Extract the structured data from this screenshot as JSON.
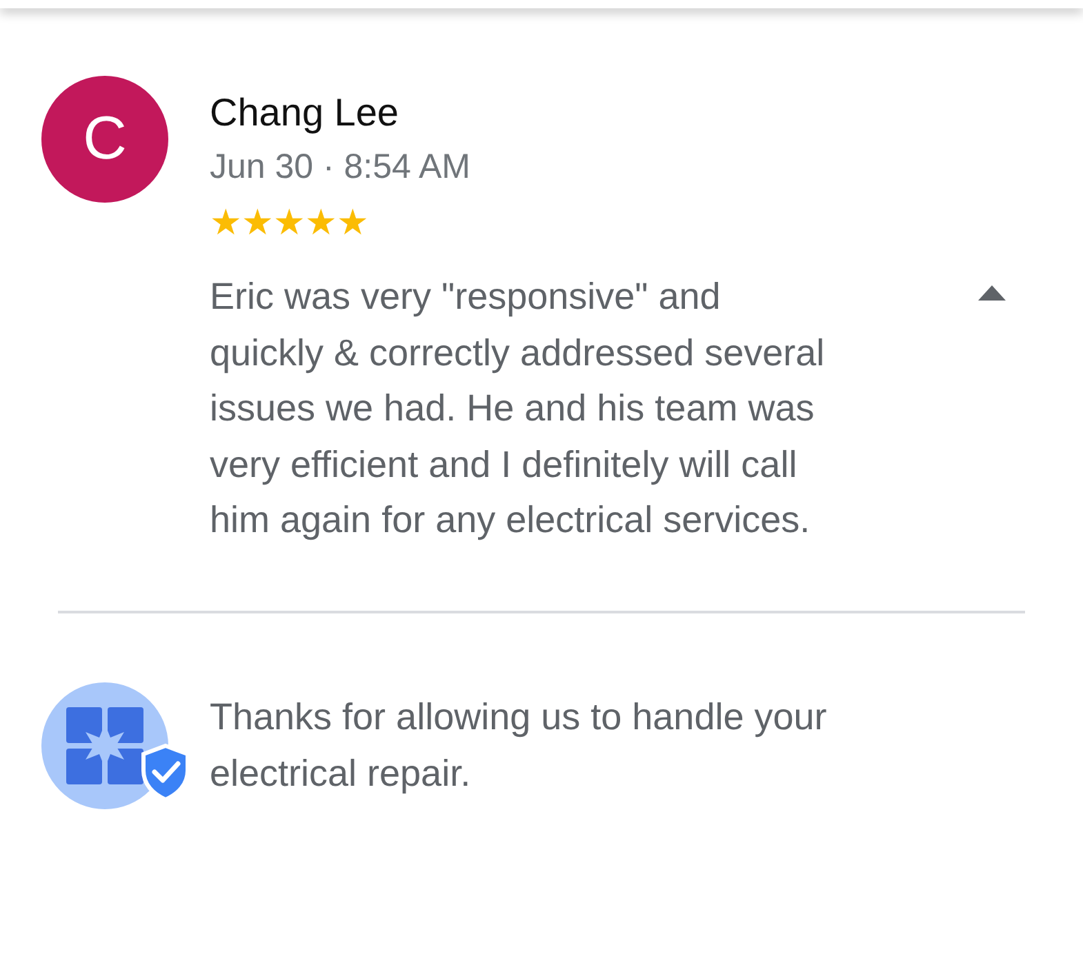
{
  "review": {
    "avatar_letter": "C",
    "author": "Chang Lee",
    "date": "Jun 30 · 8:54 AM",
    "stars": 5,
    "text": "Eric was very \"responsive\" and quickly & correctly addressed several issues we had. He and his team was very efficient and I definitely will call him again for any electrical services.",
    "expanded": true
  },
  "owner_reply": {
    "text": "Thanks for allowing us to handle your electrical repair."
  }
}
